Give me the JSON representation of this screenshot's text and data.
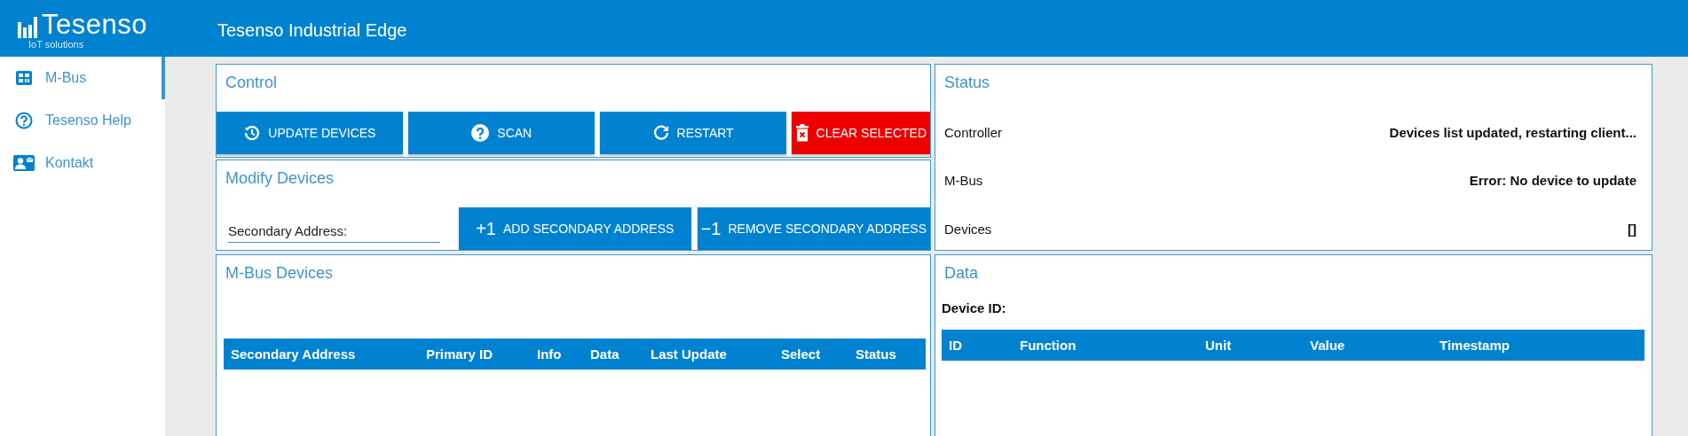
{
  "header": {
    "logo": {
      "name": "Tesenso",
      "tagline": "IoT solutions"
    },
    "title": "Tesenso Industrial Edge"
  },
  "sidebar": {
    "items": [
      {
        "label": "M-Bus",
        "selected": true
      },
      {
        "label": "Tesenso Help",
        "selected": false
      },
      {
        "label": "Kontakt",
        "selected": false
      }
    ]
  },
  "control": {
    "title": "Control",
    "buttons": [
      {
        "label": "UPDATE DEVICES",
        "kind": "primary"
      },
      {
        "label": "SCAN",
        "kind": "primary"
      },
      {
        "label": "RESTART",
        "kind": "primary"
      },
      {
        "label": "CLEAR SELECTED",
        "kind": "danger"
      }
    ]
  },
  "modify": {
    "title": "Modify Devices",
    "field": {
      "placeholder": "Secondary Address:"
    },
    "buttons": [
      {
        "glyph": "+1",
        "label": "ADD SECONDARY ADDRESS"
      },
      {
        "glyph": "−1",
        "label": "REMOVE SECONDARY ADDRESS"
      }
    ]
  },
  "status": {
    "title": "Status",
    "rows": [
      {
        "label": "Controller",
        "value": "Devices list updated, restarting client..."
      },
      {
        "label": "M-Bus",
        "value": "Error: No device to update"
      },
      {
        "label": "Devices",
        "value": "[]"
      }
    ]
  },
  "devices": {
    "title": "M-Bus Devices",
    "table": {
      "columns": [
        "Secondary Address",
        "Primary ID",
        "Info",
        "Data",
        "Last Update",
        "Select",
        "Status"
      ]
    }
  },
  "data": {
    "title": "Data",
    "device_id_label": "Device ID:",
    "table": {
      "columns": [
        "ID",
        "Function",
        "Unit",
        "Value",
        "Timestamp"
      ]
    }
  }
}
